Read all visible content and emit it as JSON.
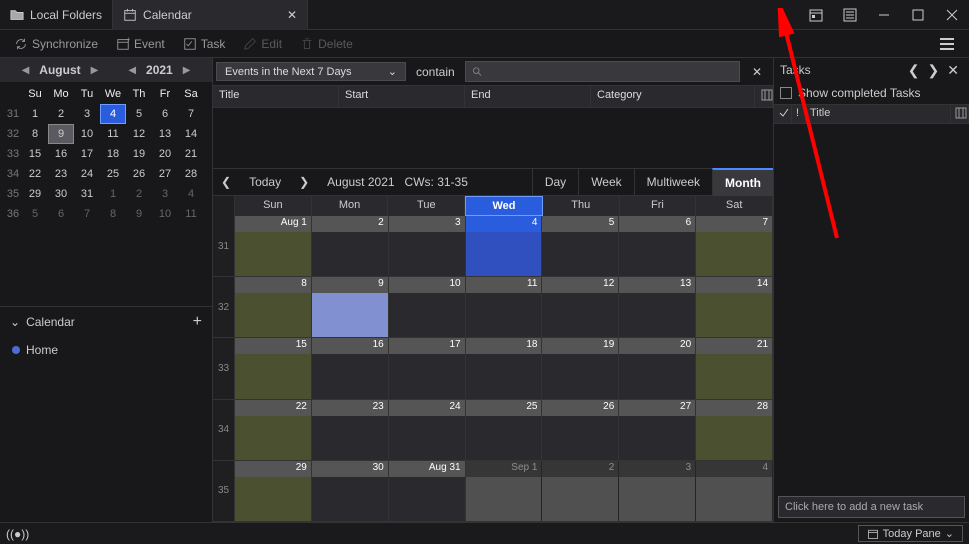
{
  "tabs": {
    "local": "Local Folders",
    "calendar": "Calendar"
  },
  "toolbar": {
    "sync": "Synchronize",
    "event": "Event",
    "task": "Task",
    "edit": "Edit",
    "delete": "Delete"
  },
  "mini": {
    "month": "August",
    "year": "2021",
    "dows": [
      "Su",
      "Mo",
      "Tu",
      "We",
      "Th",
      "Fr",
      "Sa"
    ],
    "weeks": [
      {
        "wk": "31",
        "days": [
          {
            "n": "1"
          },
          {
            "n": "2"
          },
          {
            "n": "3"
          },
          {
            "n": "4",
            "today": true
          },
          {
            "n": "5"
          },
          {
            "n": "6"
          },
          {
            "n": "7"
          }
        ]
      },
      {
        "wk": "32",
        "days": [
          {
            "n": "8"
          },
          {
            "n": "9",
            "sel": true
          },
          {
            "n": "10"
          },
          {
            "n": "11"
          },
          {
            "n": "12"
          },
          {
            "n": "13"
          },
          {
            "n": "14"
          }
        ]
      },
      {
        "wk": "33",
        "days": [
          {
            "n": "15"
          },
          {
            "n": "16"
          },
          {
            "n": "17"
          },
          {
            "n": "18"
          },
          {
            "n": "19"
          },
          {
            "n": "20"
          },
          {
            "n": "21"
          }
        ]
      },
      {
        "wk": "34",
        "days": [
          {
            "n": "22"
          },
          {
            "n": "23"
          },
          {
            "n": "24"
          },
          {
            "n": "25"
          },
          {
            "n": "26"
          },
          {
            "n": "27"
          },
          {
            "n": "28"
          }
        ]
      },
      {
        "wk": "35",
        "days": [
          {
            "n": "29"
          },
          {
            "n": "30"
          },
          {
            "n": "31"
          },
          {
            "n": "1",
            "dim": true
          },
          {
            "n": "2",
            "dim": true
          },
          {
            "n": "3",
            "dim": true
          },
          {
            "n": "4",
            "dim": true
          }
        ]
      },
      {
        "wk": "36",
        "days": [
          {
            "n": "5",
            "dim": true
          },
          {
            "n": "6",
            "dim": true
          },
          {
            "n": "7",
            "dim": true
          },
          {
            "n": "8",
            "dim": true
          },
          {
            "n": "9",
            "dim": true
          },
          {
            "n": "10",
            "dim": true
          },
          {
            "n": "11",
            "dim": true
          }
        ]
      }
    ]
  },
  "calSection": {
    "label": "Calendar",
    "home": "Home"
  },
  "filter": {
    "dropdown": "Events in the Next 7 Days",
    "contain": "contain",
    "search_placeholder": ""
  },
  "listCols": {
    "title": "Title",
    "start": "Start",
    "end": "End",
    "category": "Category"
  },
  "nav": {
    "today": "Today",
    "range": "August 2021   CWs: 31-35",
    "day": "Day",
    "week": "Week",
    "multi": "Multiweek",
    "month": "Month"
  },
  "grid": {
    "dows": [
      "Sun",
      "Mon",
      "Tue",
      "Wed",
      "Thu",
      "Fri",
      "Sat"
    ],
    "todayDow": 3,
    "weeks": [
      {
        "wk": "31",
        "cells": [
          {
            "l": "Aug 1",
            "we": true
          },
          {
            "l": "2"
          },
          {
            "l": "3"
          },
          {
            "l": "4",
            "today": true
          },
          {
            "l": "5"
          },
          {
            "l": "6"
          },
          {
            "l": "7",
            "we": true
          }
        ]
      },
      {
        "wk": "32",
        "cells": [
          {
            "l": "8",
            "we": true
          },
          {
            "l": "9",
            "sel": true
          },
          {
            "l": "10"
          },
          {
            "l": "11"
          },
          {
            "l": "12"
          },
          {
            "l": "13"
          },
          {
            "l": "14",
            "we": true
          }
        ]
      },
      {
        "wk": "33",
        "cells": [
          {
            "l": "15",
            "we": true
          },
          {
            "l": "16"
          },
          {
            "l": "17"
          },
          {
            "l": "18"
          },
          {
            "l": "19"
          },
          {
            "l": "20"
          },
          {
            "l": "21",
            "we": true
          }
        ]
      },
      {
        "wk": "34",
        "cells": [
          {
            "l": "22",
            "we": true
          },
          {
            "l": "23"
          },
          {
            "l": "24"
          },
          {
            "l": "25"
          },
          {
            "l": "26"
          },
          {
            "l": "27"
          },
          {
            "l": "28",
            "we": true
          }
        ]
      },
      {
        "wk": "35",
        "cells": [
          {
            "l": "29",
            "we": true
          },
          {
            "l": "30"
          },
          {
            "l": "Aug 31"
          },
          {
            "l": "Sep 1",
            "out": true
          },
          {
            "l": "2",
            "out": true
          },
          {
            "l": "3",
            "out": true
          },
          {
            "l": "4",
            "out": true,
            "we": true
          }
        ]
      }
    ]
  },
  "tasksPane": {
    "title": "Tasks",
    "showCompleted": "Show completed Tasks",
    "colTitle": "Title",
    "addTask": "Click here to add a new task"
  },
  "status": {
    "todayPane": "Today Pane"
  }
}
